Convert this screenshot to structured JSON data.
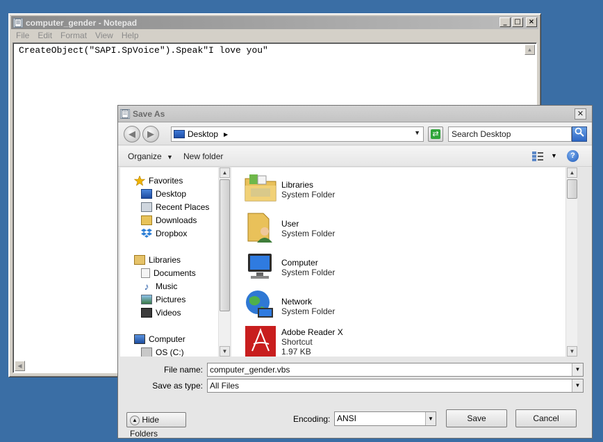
{
  "notepad": {
    "title": "computer_gender - Notepad",
    "menu": [
      "File",
      "Edit",
      "Format",
      "View",
      "Help"
    ],
    "content": "CreateObject(\"SAPI.SpVoice\").Speak\"I love you\""
  },
  "dialog": {
    "title": "Save As",
    "address": "Desktop",
    "search_placeholder": "Search Desktop",
    "organize_label": "Organize",
    "new_folder_label": "New folder",
    "nav": {
      "favorites": "Favorites",
      "favorites_items": [
        "Desktop",
        "Recent Places",
        "Downloads",
        "Dropbox"
      ],
      "libraries": "Libraries",
      "libraries_items": [
        "Documents",
        "Music",
        "Pictures",
        "Videos"
      ],
      "computer": "Computer",
      "computer_items": [
        "OS (C:)"
      ]
    },
    "files": [
      {
        "name": "Libraries",
        "type": "System Folder"
      },
      {
        "name": "User",
        "type": "System Folder"
      },
      {
        "name": "Computer",
        "type": "System Folder"
      },
      {
        "name": "Network",
        "type": "System Folder"
      },
      {
        "name": "Adobe Reader X",
        "type": "Shortcut",
        "size": "1.97 KB"
      }
    ],
    "file_name_label": "File name:",
    "file_name_value": "computer_gender.vbs",
    "save_as_type_label": "Save as type:",
    "save_as_type_value": "All Files",
    "hide_folders_label": "Hide Folders",
    "encoding_label": "Encoding:",
    "encoding_value": "ANSI",
    "save_label": "Save",
    "cancel_label": "Cancel"
  },
  "colors": {
    "desktop": "#3a6ea5",
    "dialog_bg": "#e6e6e6"
  }
}
